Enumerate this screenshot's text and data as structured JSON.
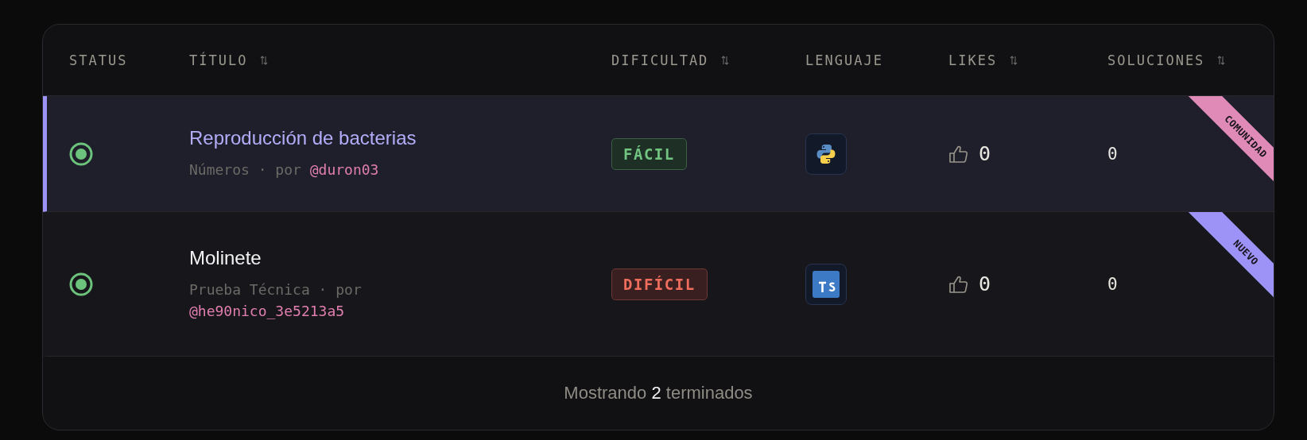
{
  "table": {
    "columns": [
      {
        "label": "STATUS",
        "sortable": false
      },
      {
        "label": "TÍTULO",
        "sortable": true
      },
      {
        "label": "DIFICULTAD",
        "sortable": true
      },
      {
        "label": "LENGUAJE",
        "sortable": false
      },
      {
        "label": "LIKES",
        "sortable": true
      },
      {
        "label": "SOLUCIONES",
        "sortable": true
      }
    ],
    "rows": [
      {
        "selected": true,
        "title": "Reproducción de bacterias",
        "category": "Números · por",
        "author": "@duron03",
        "difficulty": {
          "label": "FÁCIL",
          "kind": "easy"
        },
        "language": {
          "kind": "python"
        },
        "likes": "0",
        "solutions": "0",
        "ribbon": {
          "label": "COMUNIDAD",
          "color": "#e08ab8"
        }
      },
      {
        "selected": false,
        "title": "Molinete",
        "category": "Prueba Técnica · por",
        "author": "@he90nico_3e5213a5",
        "difficulty": {
          "label": "DIFÍCIL",
          "kind": "hard"
        },
        "language": {
          "kind": "typescript"
        },
        "likes": "0",
        "solutions": "0",
        "ribbon": {
          "label": "NUEVO",
          "color": "#9d92f5"
        }
      }
    ]
  },
  "footer": "Mostrando **2** terminados"
}
